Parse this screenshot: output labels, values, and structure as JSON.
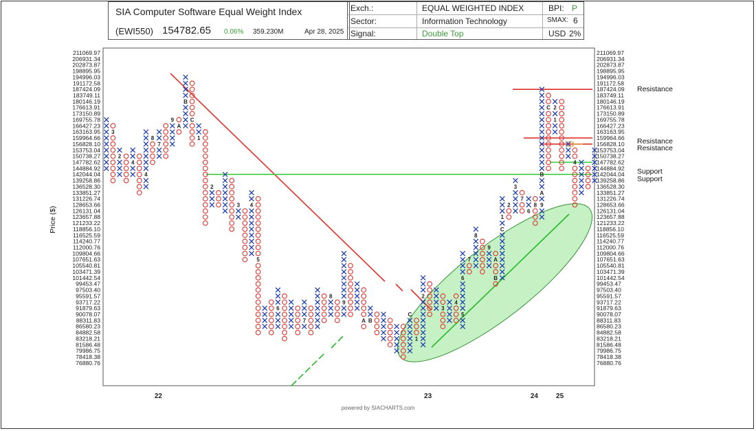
{
  "header": {
    "title": "SIA Computer Software Equal Weight Index",
    "ticker": "(EWI550)",
    "price": "154782.65",
    "change": "0.06%",
    "volume": "359.230M",
    "date": "Apr 28, 2025",
    "exch_label": "Exch.:",
    "exch_value": "EQUAL WEIGHTED INDEX",
    "sector_label": "Sector:",
    "sector_value": "Information Technology",
    "signal_label": "Signal:",
    "signal_value": "Double Top",
    "bpi_label": "BPI:",
    "bpi_value": "P",
    "smax_label": "SMAX:",
    "smax_value": "6",
    "usd_label": "USD",
    "usd_value": "2%"
  },
  "footer": "powered by SIACHARTS.com",
  "colors": {
    "x": "#1f3fb0",
    "o": "#d9453e",
    "resistance": "#e0302a",
    "support": "#3ccf3c",
    "band": "#7fe07f"
  },
  "chart_data": {
    "type": "point-and-figure",
    "title": "SIA Computer Software Equal Weight Index",
    "ylabel": "Price ($)",
    "grid": false,
    "box_levels": [
      "211069.97",
      "206931.34",
      "202873.87",
      "198895.95",
      "194996.03",
      "191172.58",
      "187424.09",
      "183749.11",
      "180146.19",
      "176613.91",
      "173150.89",
      "169755.78",
      "166427.23",
      "163163.95",
      "159964.66",
      "156828.10",
      "153753.04",
      "150738.27",
      "147782.62",
      "144884.92",
      "142044.04",
      "139258.86",
      "136528.30",
      "133851.27",
      "131226.74",
      "128653.66",
      "126131.04",
      "123657.88",
      "121233.22",
      "118856.10",
      "116525.59",
      "114240.77",
      "112000.76",
      "109804.66",
      "107651.63",
      "105540.81",
      "103471.39",
      "101442.54",
      "99453.47",
      "97503.40",
      "95591.57",
      "93717.22",
      "91879.63",
      "90078.07",
      "88311.83",
      "86580.23",
      "84882.58",
      "83218.21",
      "81586.48",
      "79986.75",
      "78418.38",
      "76880.76"
    ],
    "x_axis_labels": [
      "22",
      "23",
      "24",
      "25"
    ],
    "columns": [
      {
        "type": "X",
        "lo": 144884.92,
        "hi": 169755.78
      },
      {
        "type": "O",
        "lo": 139258.86,
        "hi": 166427.23,
        "marks": [
          {
            "level": 163163.95,
            "text": "3"
          }
        ]
      },
      {
        "type": "X",
        "lo": 142044.04,
        "hi": 153753.04,
        "marks": [
          {
            "level": 150738.27,
            "text": "2"
          }
        ]
      },
      {
        "type": "O",
        "lo": 139258.86,
        "hi": 150738.27
      },
      {
        "type": "X",
        "lo": 142044.04,
        "hi": 153753.04,
        "marks": [
          {
            "level": 147782.62,
            "text": "4"
          }
        ]
      },
      {
        "type": "O",
        "lo": 133851.27,
        "hi": 150738.27
      },
      {
        "type": "X",
        "lo": 136528.3,
        "hi": 163163.95,
        "marks": [
          {
            "level": 142044.04,
            "text": "4"
          }
        ]
      },
      {
        "type": "O",
        "lo": 147782.62,
        "hi": 159964.66,
        "marks": [
          {
            "level": 159964.66,
            "text": "8"
          }
        ]
      },
      {
        "type": "X",
        "lo": 150738.27,
        "hi": 163163.95,
        "marks": [
          {
            "level": 156828.1,
            "text": "7"
          }
        ]
      },
      {
        "type": "O",
        "lo": 150738.27,
        "hi": 166427.23
      },
      {
        "type": "X",
        "lo": 156828.1,
        "hi": 169755.78,
        "marks": [
          {
            "level": 169755.78,
            "text": "9"
          }
        ]
      },
      {
        "type": "O",
        "lo": 163163.95,
        "hi": 169755.78,
        "marks": [
          {
            "level": 166427.23,
            "text": "A"
          }
        ]
      },
      {
        "type": "X",
        "lo": 166427.23,
        "hi": 194996.03,
        "marks": [
          {
            "level": 180146.19,
            "text": "B"
          }
        ]
      },
      {
        "type": "O",
        "lo": 156828.1,
        "hi": 191172.58,
        "marks": [
          {
            "level": 169755.78,
            "text": "C"
          }
        ]
      },
      {
        "type": "X",
        "lo": 159964.66,
        "hi": 166427.23,
        "marks": [
          {
            "level": 159964.66,
            "text": "1"
          }
        ]
      },
      {
        "type": "O",
        "lo": 121233.22,
        "hi": 163163.95
      },
      {
        "type": "X",
        "lo": 128653.66,
        "hi": 136528.3,
        "marks": [
          {
            "level": 136528.3,
            "text": "2"
          }
        ]
      },
      {
        "type": "O",
        "lo": 128653.66,
        "hi": 133851.27
      },
      {
        "type": "X",
        "lo": 126131.04,
        "hi": 142044.04
      },
      {
        "type": "O",
        "lo": 118856.1,
        "hi": 139258.86
      },
      {
        "type": "X",
        "lo": 123657.88,
        "hi": 128653.66,
        "marks": [
          {
            "level": 128653.66,
            "text": "3"
          }
        ]
      },
      {
        "type": "O",
        "lo": 107651.63,
        "hi": 126131.04
      },
      {
        "type": "X",
        "lo": 109804.66,
        "hi": 133851.27,
        "marks": [
          {
            "level": 128653.66,
            "text": "4"
          }
        ]
      },
      {
        "type": "O",
        "lo": 84882.58,
        "hi": 131226.74,
        "marks": [
          {
            "level": 107651.63,
            "text": "5"
          }
        ]
      },
      {
        "type": "X",
        "lo": 86580.23,
        "hi": 91879.63
      },
      {
        "type": "O",
        "lo": 84882.58,
        "hi": 93717.22
      },
      {
        "type": "X",
        "lo": 86580.23,
        "hi": 97503.4,
        "marks": [
          {
            "level": 91879.63,
            "text": "6"
          }
        ]
      },
      {
        "type": "O",
        "lo": 83218.21,
        "hi": 95591.57
      },
      {
        "type": "X",
        "lo": 86580.23,
        "hi": 93717.22
      },
      {
        "type": "O",
        "lo": 84882.58,
        "hi": 91879.63
      },
      {
        "type": "X",
        "lo": 86580.23,
        "hi": 93717.22,
        "marks": [
          {
            "level": 88311.83,
            "text": "7"
          }
        ]
      },
      {
        "type": "O",
        "lo": 84882.58,
        "hi": 91879.63
      },
      {
        "type": "X",
        "lo": 86580.23,
        "hi": 97503.4
      },
      {
        "type": "O",
        "lo": 88311.83,
        "hi": 95591.57
      },
      {
        "type": "X",
        "lo": 90078.07,
        "hi": 95591.57,
        "marks": [
          {
            "level": 95591.57,
            "text": "8"
          }
        ]
      },
      {
        "type": "O",
        "lo": 88311.83,
        "hi": 93717.22
      },
      {
        "type": "X",
        "lo": 90078.07,
        "hi": 109804.66,
        "marks": [
          {
            "level": 93717.22,
            "text": "9"
          }
        ]
      },
      {
        "type": "O",
        "lo": 90078.07,
        "hi": 105540.81
      },
      {
        "type": "X",
        "lo": 91879.63,
        "hi": 99453.47
      },
      {
        "type": "O",
        "lo": 86580.23,
        "hi": 97503.4,
        "marks": [
          {
            "level": 88311.83,
            "text": "A"
          }
        ]
      },
      {
        "type": "X",
        "lo": 88311.83,
        "hi": 91879.63,
        "marks": [
          {
            "level": 88311.83,
            "text": "B"
          }
        ]
      },
      {
        "type": "O",
        "lo": 84882.58,
        "hi": 90078.07
      },
      {
        "type": "X",
        "lo": 83218.21,
        "hi": 90078.07
      },
      {
        "type": "O",
        "lo": 81586.48,
        "hi": 88311.83
      },
      {
        "type": "X",
        "lo": 79986.75,
        "hi": 86580.23
      },
      {
        "type": "O",
        "lo": 78418.38,
        "hi": 86580.23
      },
      {
        "type": "X",
        "lo": 79986.75,
        "hi": 90078.07,
        "marks": [
          {
            "level": 90078.07,
            "text": "C"
          }
        ]
      },
      {
        "type": "O",
        "lo": 83218.21,
        "hi": 88311.83,
        "marks": [
          {
            "level": 83218.21,
            "text": "1"
          }
        ]
      },
      {
        "type": "X",
        "lo": 81586.48,
        "hi": 101442.54,
        "marks": [
          {
            "level": 95591.57,
            "text": "2"
          }
        ]
      },
      {
        "type": "O",
        "lo": 90078.07,
        "hi": 99453.47
      },
      {
        "type": "X",
        "lo": 91879.63,
        "hi": 97503.4
      },
      {
        "type": "O",
        "lo": 86580.23,
        "hi": 95591.57,
        "marks": [
          {
            "level": 91879.63,
            "text": "3"
          }
        ]
      },
      {
        "type": "X",
        "lo": 88311.83,
        "hi": 93717.22
      },
      {
        "type": "O",
        "lo": 88311.83,
        "hi": 95591.57,
        "marks": [
          {
            "level": 93717.22,
            "text": "4"
          }
        ]
      },
      {
        "type": "X",
        "lo": 86580.23,
        "hi": 109804.66,
        "marks": [
          {
            "level": 90078.07,
            "text": "5"
          },
          {
            "level": 101442.54,
            "text": "6"
          }
        ]
      },
      {
        "type": "O",
        "lo": 103471.39,
        "hi": 107651.63,
        "marks": [
          {
            "level": 107651.63,
            "text": "7"
          }
        ]
      },
      {
        "type": "X",
        "lo": 105540.81,
        "hi": 118856.1,
        "marks": [
          {
            "level": 116525.59,
            "text": "8"
          }
        ]
      },
      {
        "type": "O",
        "lo": 103471.39,
        "hi": 114240.77
      },
      {
        "type": "X",
        "lo": 105540.81,
        "hi": 112000.76,
        "marks": [
          {
            "level": 112000.76,
            "text": "9"
          }
        ]
      },
      {
        "type": "O",
        "lo": 99453.47,
        "hi": 109804.66,
        "marks": [
          {
            "level": 107651.63,
            "text": "A"
          },
          {
            "level": 101442.54,
            "text": "B"
          }
        ]
      },
      {
        "type": "X",
        "lo": 101442.54,
        "hi": 131226.74,
        "marks": [
          {
            "level": 118856.1,
            "text": "C"
          },
          {
            "level": 123657.88,
            "text": "1"
          }
        ]
      },
      {
        "type": "O",
        "lo": 123657.88,
        "hi": 128653.66,
        "marks": [
          {
            "level": 128653.66,
            "text": "2"
          }
        ]
      },
      {
        "type": "X",
        "lo": 126131.04,
        "hi": 139258.86,
        "marks": [
          {
            "level": 136528.3,
            "text": "3"
          }
        ]
      },
      {
        "type": "O",
        "lo": 126131.04,
        "hi": 133851.27,
        "marks": [
          {
            "level": 131226.74,
            "text": "7"
          }
        ]
      },
      {
        "type": "X",
        "lo": 126131.04,
        "hi": 131226.74,
        "marks": [
          {
            "level": 126131.04,
            "text": "6"
          }
        ]
      },
      {
        "type": "O",
        "lo": 121233.22,
        "hi": 131226.74,
        "marks": [
          {
            "level": 128653.66,
            "text": "8"
          }
        ]
      },
      {
        "type": "X",
        "lo": 123657.88,
        "hi": 187424.09,
        "marks": [
          {
            "level": 142044.04,
            "text": "B"
          },
          {
            "level": 128653.66,
            "text": "9"
          },
          {
            "level": 133851.27,
            "text": "A"
          }
        ]
      },
      {
        "type": "O",
        "lo": 144884.92,
        "hi": 183749.11,
        "marks": [
          {
            "level": 176613.91,
            "text": "C"
          }
        ]
      },
      {
        "type": "X",
        "lo": 163163.95,
        "hi": 180146.19,
        "marks": [
          {
            "level": 176613.91,
            "text": "2"
          },
          {
            "level": 169755.78,
            "text": "1"
          }
        ]
      },
      {
        "type": "O",
        "lo": 144884.92,
        "hi": 180146.19
      },
      {
        "type": "X",
        "lo": 150738.27,
        "hi": 156828.1,
        "marks": [
          {
            "level": 159964.66,
            "text": "3"
          }
        ]
      },
      {
        "type": "O",
        "lo": 128653.66,
        "hi": 153753.04,
        "marks": [
          {
            "level": 147782.62,
            "text": "4"
          }
        ]
      },
      {
        "type": "X",
        "lo": 133851.27,
        "hi": 147782.62
      },
      {
        "type": "O",
        "lo": 136528.3,
        "hi": 144884.92
      },
      {
        "type": "X",
        "lo": 139258.86,
        "hi": 153753.04
      }
    ],
    "resistance_levels": [
      {
        "level": 187424.09,
        "label": "Resistance"
      },
      {
        "level": 159964.66,
        "label": "Resistance"
      },
      {
        "level": 156828.1,
        "label": "Resistance"
      }
    ],
    "support_levels": [
      {
        "level": 147782.62,
        "label": "Support"
      },
      {
        "level": 142044.04,
        "label": "Support"
      }
    ]
  }
}
